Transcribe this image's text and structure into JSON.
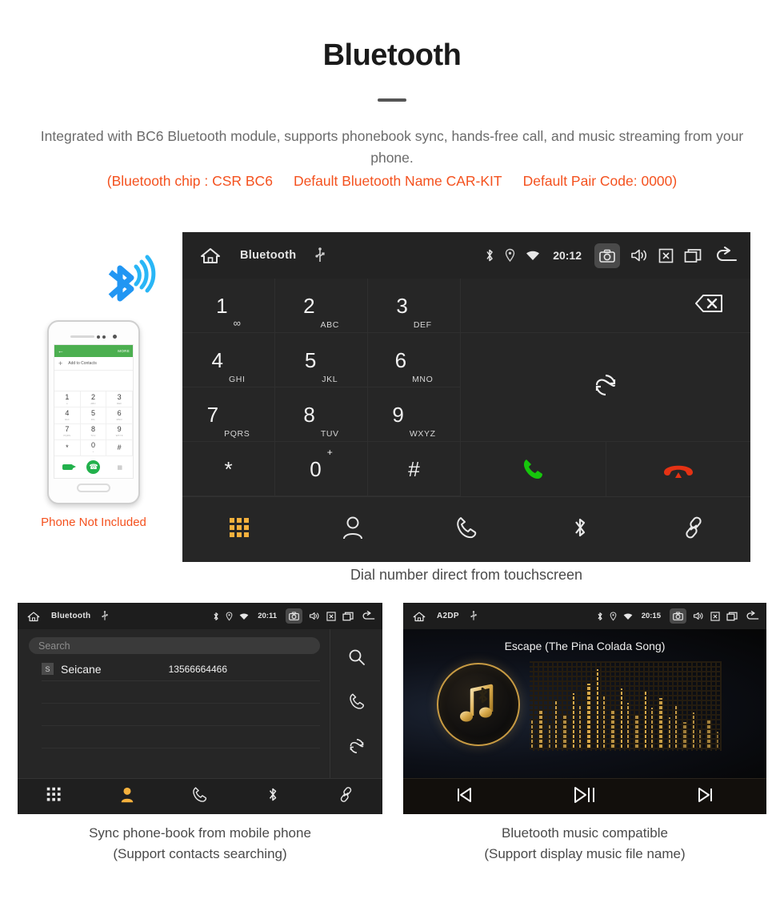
{
  "header": {
    "title": "Bluetooth",
    "description": "Integrated with BC6 Bluetooth module, supports phonebook sync, hands-free call, and music streaming from your phone.",
    "spec_chip": "(Bluetooth chip : CSR BC6",
    "spec_name": "Default Bluetooth Name CAR-KIT",
    "spec_pair": "Default Pair Code: 0000)",
    "accent_color": "#f4511e",
    "body_color": "#6b6b6b"
  },
  "phone_mock": {
    "caption": "Phone Not Included",
    "topbar_more": "MORE",
    "add_contacts": "Add to Contacts",
    "keys": [
      {
        "num": "1",
        "sub": "∞"
      },
      {
        "num": "2",
        "sub": "ABC"
      },
      {
        "num": "3",
        "sub": "DEF"
      },
      {
        "num": "4",
        "sub": "GHI"
      },
      {
        "num": "5",
        "sub": "JKL"
      },
      {
        "num": "6",
        "sub": "MNO"
      },
      {
        "num": "7",
        "sub": "PQRS"
      },
      {
        "num": "8",
        "sub": "TUV"
      },
      {
        "num": "9",
        "sub": "WXYZ"
      },
      {
        "num": "*",
        "sub": ""
      },
      {
        "num": "0",
        "sub": "+"
      },
      {
        "num": "#",
        "sub": ""
      }
    ]
  },
  "dialer": {
    "statusbar": {
      "title": "Bluetooth",
      "clock": "20:12",
      "icons": [
        "home-icon",
        "usb-icon",
        "bluetooth-icon",
        "location-icon",
        "wifi-icon",
        "camera-icon",
        "volume-icon",
        "close-box-icon",
        "recents-icon",
        "back-icon"
      ]
    },
    "keys": [
      {
        "num": "1",
        "sub": "voicemail"
      },
      {
        "num": "2",
        "sub": "ABC"
      },
      {
        "num": "3",
        "sub": "DEF"
      },
      {
        "num": "4",
        "sub": "GHI"
      },
      {
        "num": "5",
        "sub": "JKL"
      },
      {
        "num": "6",
        "sub": "MNO"
      },
      {
        "num": "7",
        "sub": "PQRS"
      },
      {
        "num": "8",
        "sub": "TUV"
      },
      {
        "num": "9",
        "sub": "WXYZ"
      },
      {
        "num": "*",
        "sub": ""
      },
      {
        "num": "0",
        "sub": "+"
      },
      {
        "num": "#",
        "sub": ""
      }
    ],
    "number_value": "",
    "nav": [
      {
        "name": "keypad",
        "active": true
      },
      {
        "name": "contacts",
        "active": false
      },
      {
        "name": "call-history",
        "active": false
      },
      {
        "name": "bluetooth",
        "active": false
      },
      {
        "name": "pair-link",
        "active": false
      }
    ],
    "caption": "Dial number direct from touchscreen",
    "active_color": "#f5b13d"
  },
  "phonebook": {
    "statusbar": {
      "title": "Bluetooth",
      "clock": "20:11"
    },
    "search_placeholder": "Search",
    "search_value": "",
    "contacts": [
      {
        "initial": "S",
        "name": "Seicane",
        "number": "13566664466"
      }
    ],
    "side_actions": [
      "search-icon",
      "call-icon",
      "sync-icon"
    ],
    "nav": [
      {
        "name": "keypad",
        "active": false
      },
      {
        "name": "contacts",
        "active": true
      },
      {
        "name": "call-history",
        "active": false
      },
      {
        "name": "bluetooth",
        "active": false
      },
      {
        "name": "pair-link",
        "active": false
      }
    ],
    "caption_line1": "Sync phone-book from mobile phone",
    "caption_line2": "(Support contacts searching)"
  },
  "music": {
    "statusbar": {
      "title": "A2DP",
      "clock": "20:15"
    },
    "track_title": "Escape (The Pina Colada Song)",
    "controls": [
      "previous-icon",
      "play-pause-icon",
      "next-icon"
    ],
    "caption_line1": "Bluetooth music compatible",
    "caption_line2": "(Support display music file name)"
  }
}
